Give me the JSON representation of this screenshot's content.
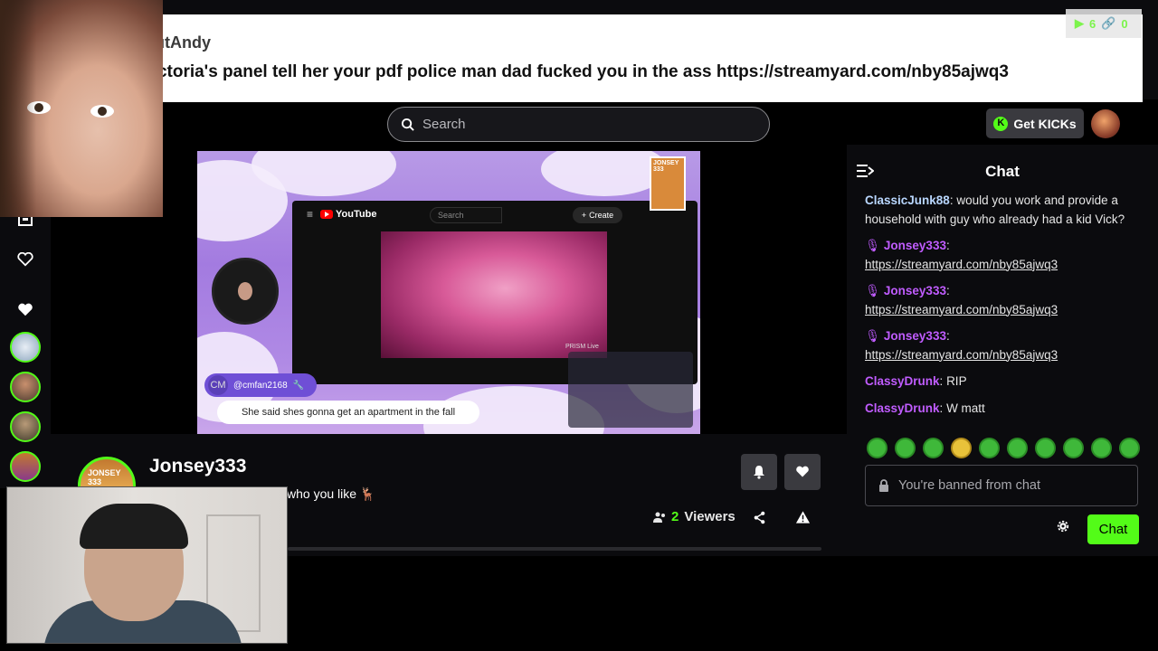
{
  "notification": {
    "username": "BlackoutAndy",
    "message": "Join Victoria's panel tell her your pdf police man dad fucked you in the ass https://streamyard.com/nby85ajwq3"
  },
  "overlay_stats": {
    "watch_count": "6",
    "link_count": "0"
  },
  "header": {
    "search_placeholder": "Search",
    "get_kicks_label": "Get KICKs"
  },
  "video": {
    "yt_logo": "YouTube",
    "yt_search_placeholder": "Search",
    "yt_create_label": "Create",
    "badge_text": "JONSEY 333",
    "commenter": "@cmfan2168",
    "commenter_initials": "CM",
    "caption": "She said shes gonna get an apartment in the fall",
    "live_label": "PRISM Live"
  },
  "stream": {
    "streamer": "Jonsey333",
    "title_fragment": "who you like 🦌",
    "viewers_count": "2",
    "viewers_label": "Viewers",
    "avatar_text": "JONSEY 333"
  },
  "chat": {
    "title": "Chat",
    "messages": [
      {
        "user": "ClassicJunk88",
        "user_color": "#b9d7ff",
        "text": "would you work and provide a household with guy who already had a kid Vick?"
      },
      {
        "user": "Jonsey333",
        "user_color": "#c05cff",
        "text": "https://streamyard.com/nby85ajwq3"
      },
      {
        "user": "Jonsey333",
        "user_color": "#c05cff",
        "text": "https://streamyard.com/nby85ajwq3"
      },
      {
        "user": "Jonsey333",
        "user_color": "#c05cff",
        "text": "https://streamyard.com/nby85ajwq3"
      },
      {
        "user": "ClassyDrunk",
        "user_color": "#c05cff",
        "text": "RIP"
      },
      {
        "user": "ClassyDrunk",
        "user_color": "#c05cff",
        "text": "W matt"
      }
    ],
    "banned_placeholder": "You're banned from chat",
    "send_label": "Chat"
  },
  "colors": {
    "kick_green": "#53fc18",
    "bg": "#0b0b0e",
    "mod_purple": "#c05cff"
  }
}
